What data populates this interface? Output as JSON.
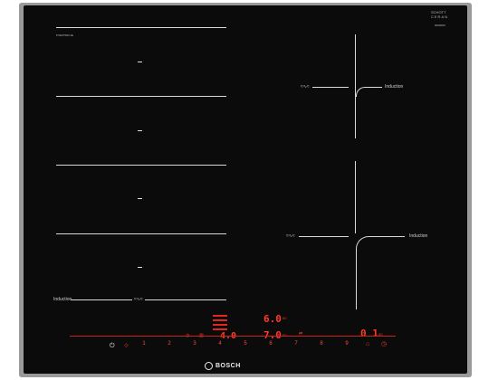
{
  "product": {
    "brand": "BOSCH",
    "model_code": "PXE675DC1E",
    "glass_brand_line1": "SCHOTT",
    "glass_brand_line2": "CERAN",
    "glass_code": "0000000"
  },
  "zones": {
    "left_dashes": [
      "–",
      "–",
      "–",
      "–"
    ],
    "flex_label": "Induction",
    "flex_symbol": "≈∿≈",
    "right_top_label": "Induction",
    "right_top_symbol": "≈∿≈",
    "right_bottom_label": "Induction",
    "right_bottom_symbol": "≈∿≈"
  },
  "display": {
    "top_value": "6.0",
    "middle_value": "7.0",
    "left_value": "4.0",
    "right_value": "0 1",
    "small_label_1": "00",
    "small_label_2": "00",
    "small_right": "00",
    "timer_icon": "timer-icon"
  },
  "controls": {
    "power_icon": "power-icon",
    "slider_numbers": [
      "1",
      "2",
      "3",
      "4",
      "5",
      "6",
      "7",
      "8",
      "9"
    ],
    "boost_icon": "boost-icon",
    "child_lock_icon": "lock-icon"
  },
  "colors": {
    "glass": "#0b0b0b",
    "frame": "#9a9a9a",
    "display_red": "#ff3b2b",
    "marking_white": "#d8d8d8"
  }
}
